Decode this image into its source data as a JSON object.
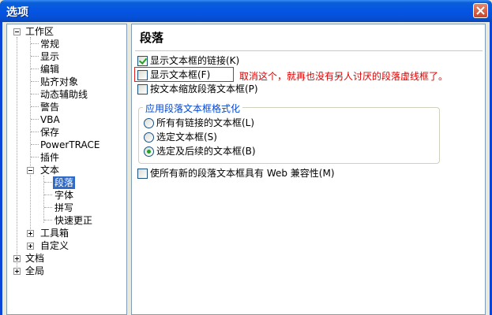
{
  "window": {
    "title": "选项"
  },
  "tree": {
    "workspace": "工作区",
    "workspace_children": [
      "常规",
      "显示",
      "编辑",
      "贴齐对象",
      "动态辅助线",
      "警告",
      "VBA",
      "保存",
      "PowerTRACE",
      "插件"
    ],
    "text": "文本",
    "text_children": [
      "段落",
      "字体",
      "拼写",
      "快速更正"
    ],
    "toolbox": "工具箱",
    "customize": "自定义",
    "document": "文档",
    "global": "全局"
  },
  "panel": {
    "heading": "段落",
    "opt_show_links": "显示文本框的链接(K)",
    "opt_show_links_checked": true,
    "opt_show_frame": "显示文本框(F)",
    "opt_show_frame_checked": false,
    "annotation": "取消这个，就再也没有另人讨厌的段落虚线框了。",
    "opt_scale": "按文本缩放段落文本框(P)",
    "opt_scale_checked": false,
    "group_title": "应用段落文本框格式化",
    "radio_all": "所有有链接的文本框(L)",
    "radio_selected": "选定文本框(S)",
    "radio_selected_following": "选定及后续的文本框(B)",
    "radio_value": "选定及后续的文本框(B)",
    "opt_web": "使所有新的段落文本框具有 Web 兼容性(M)",
    "opt_web_checked": false
  },
  "icons": {
    "close": "close-icon",
    "tree_expand": "plus-icon",
    "tree_collapse": "minus-icon"
  },
  "colors": {
    "titlebar": "#0554e3",
    "selection": "#316ac5",
    "annotation": "#e00000",
    "group_title": "#0046d5"
  }
}
